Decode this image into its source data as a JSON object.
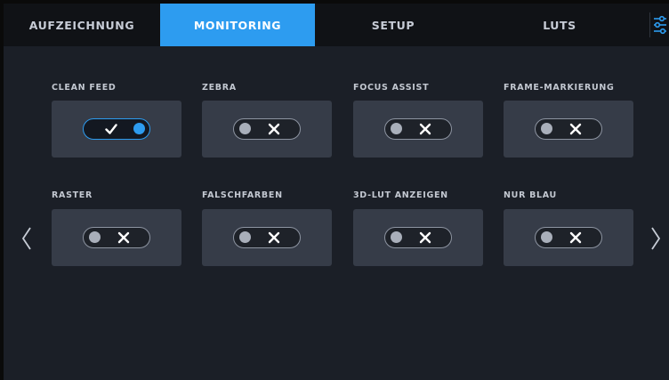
{
  "tabs": [
    {
      "label": "AUFZEICHNUNG",
      "active": false
    },
    {
      "label": "MONITORING",
      "active": true
    },
    {
      "label": "SETUP",
      "active": false
    },
    {
      "label": "LUTS",
      "active": false
    }
  ],
  "settings_icon": "sliders-icon",
  "toggles": [
    {
      "label": "CLEAN FEED",
      "on": true
    },
    {
      "label": "ZEBRA",
      "on": false
    },
    {
      "label": "FOCUS ASSIST",
      "on": false
    },
    {
      "label": "FRAME-MARKIERUNG",
      "on": false
    },
    {
      "label": "RASTER",
      "on": false
    },
    {
      "label": "FALSCHFARBEN",
      "on": false
    },
    {
      "label": "3D-LUT ANZEIGEN",
      "on": false
    },
    {
      "label": "NUR BLAU",
      "on": false
    }
  ],
  "nav": {
    "prev_icon": "chevron-left-icon",
    "next_icon": "chevron-right-icon"
  },
  "colors": {
    "accent": "#2d9cf0",
    "background": "#1b1f27",
    "tile": "#363c48",
    "tabbar": "#101216"
  }
}
